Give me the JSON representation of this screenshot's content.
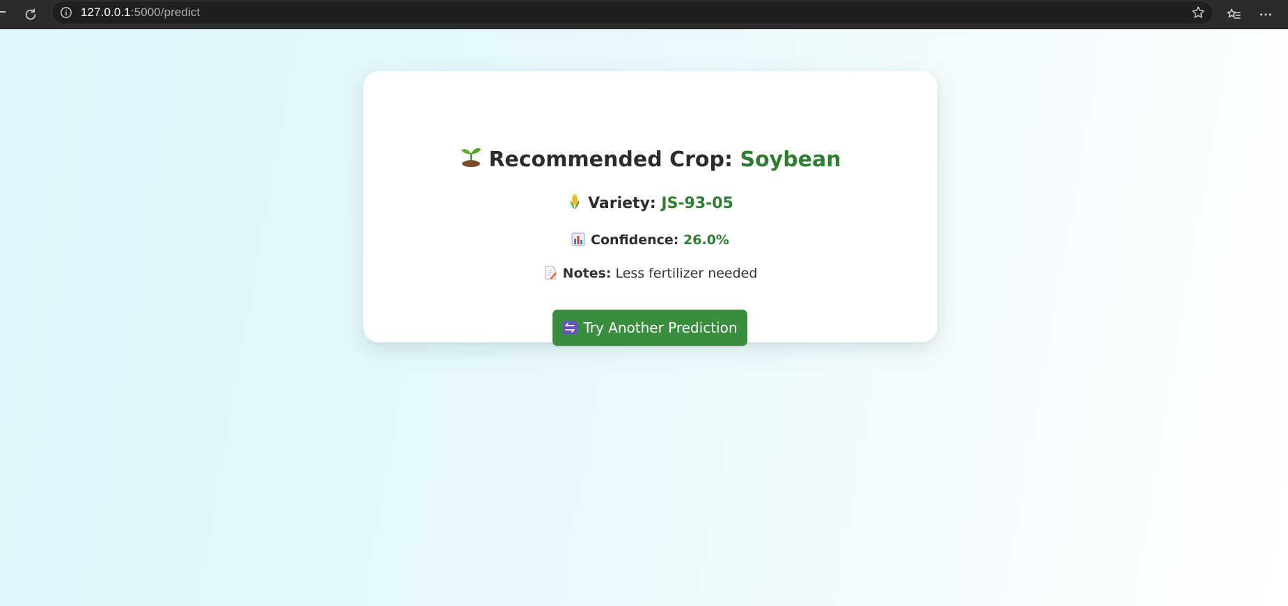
{
  "browser": {
    "url_host": "127.0.0.1",
    "url_rest": ":5000/predict",
    "back_icon": "back-arrow-icon",
    "reload_icon": "reload-icon",
    "info_icon": "info-icon",
    "favorite_icon": "star-icon",
    "favorites_list_icon": "favorites-list-icon",
    "menu_icon": "more-options-icon"
  },
  "result": {
    "crop_label": "Recommended Crop:",
    "crop_value": "Soybean",
    "crop_icon": "seedling-icon",
    "variety_label": "Variety:",
    "variety_value": "JS-93-05",
    "variety_icon": "corn-icon",
    "confidence_label": "Confidence:",
    "confidence_value": "26.0%",
    "confidence_icon": "bar-chart-icon",
    "notes_label": "Notes:",
    "notes_value": "Less fertilizer needed",
    "notes_icon": "memo-icon"
  },
  "action": {
    "button_label": "Try Another Prediction",
    "button_icon": "arrows-icon"
  },
  "colors": {
    "accent_green": "#2e7d32",
    "button_green": "#388e3c",
    "text_dark": "#2c2c2c"
  }
}
